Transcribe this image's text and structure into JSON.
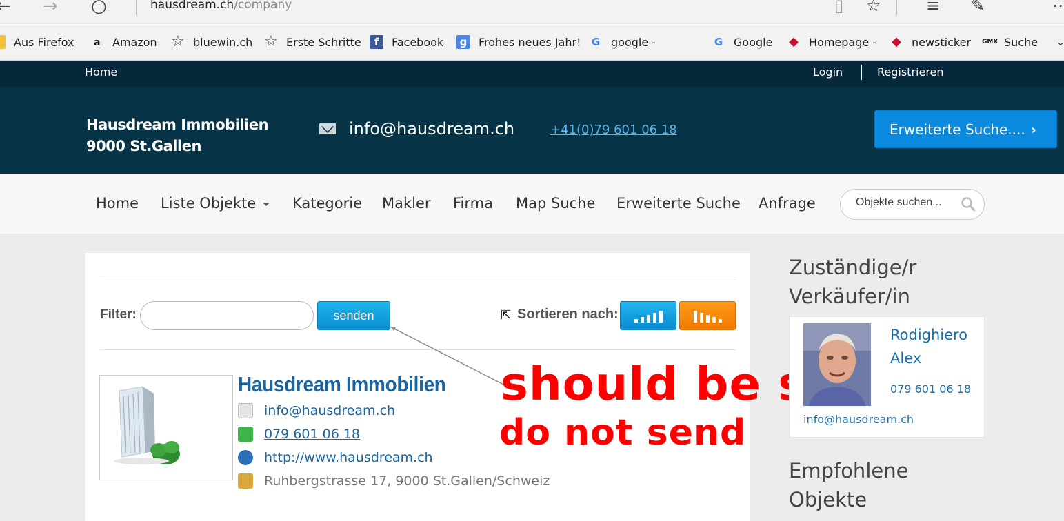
{
  "browser": {
    "url_host": "hausdream.ch",
    "url_path": "/company",
    "bookmarks": [
      {
        "label": "Aus Firefox",
        "icon": "folder-icon",
        "glyph": ""
      },
      {
        "label": "Amazon",
        "icon": "amazon-icon",
        "glyph": "a"
      },
      {
        "label": "bluewin.ch",
        "icon": "star-icon",
        "glyph": "☆"
      },
      {
        "label": "Erste Schritte",
        "icon": "star-icon",
        "glyph": "☆"
      },
      {
        "label": "Facebook",
        "icon": "facebook-icon",
        "glyph": "f"
      },
      {
        "label": "Frohes neues Jahr!",
        "icon": "google-plus-icon",
        "glyph": "g"
      },
      {
        "label": "google -",
        "icon": "google-icon",
        "glyph": "G"
      },
      {
        "label": "Google",
        "icon": "google-icon",
        "glyph": "G"
      },
      {
        "label": "Homepage -",
        "icon": "swisscom-icon",
        "glyph": "◆"
      },
      {
        "label": "newsticker",
        "icon": "swisscom-icon",
        "glyph": "◆"
      },
      {
        "label": "Suche",
        "icon": "gmx-icon",
        "glyph": "GMX"
      }
    ]
  },
  "topbar": {
    "home": "Home",
    "login": "Login",
    "register": "Registrieren"
  },
  "header": {
    "brand_line1": "Hausdream Immobilien",
    "brand_line2": "9000 St.Gallen",
    "email": "info@hausdream.ch",
    "phone": "+41(0)79 601 06 18",
    "advanced_search": "Erweiterte Suche...."
  },
  "nav": {
    "items": [
      "Home",
      "Liste Objekte",
      "Kategorie",
      "Makler",
      "Firma",
      "Map Suche",
      "Erweiterte Suche",
      "Anfrage"
    ],
    "search_placeholder": "Objekte suchen..."
  },
  "filter": {
    "label": "Filter:",
    "value": "",
    "send": "senden",
    "sort_label": "Sortieren nach:"
  },
  "company": {
    "name": "Hausdream Immobilien",
    "email": "info@hausdream.ch",
    "phone": "079 601 06 18",
    "website": "http://www.hausdream.ch",
    "address": "Ruhbergstrasse 17, 9000 St.Gallen/Schweiz"
  },
  "annotation": {
    "line1": "should be search",
    "line2": "do not send"
  },
  "sidebar": {
    "agent_title_1": "Zuständige/r",
    "agent_title_2": "Verkäufer/in",
    "agent_first": "Rodighiero",
    "agent_last": "Alex",
    "agent_phone": "079 601 06 18",
    "agent_email": "info@hausdream.ch",
    "recommended_1": "Empfohlene",
    "recommended_2": "Objekte"
  },
  "colors": {
    "topbar_bg": "#06283a",
    "header_bg": "#073347",
    "accent_blue": "#0b8be0",
    "accent_orange": "#f07a00",
    "link": "#1a64a0",
    "annotation": "#ff0000"
  }
}
